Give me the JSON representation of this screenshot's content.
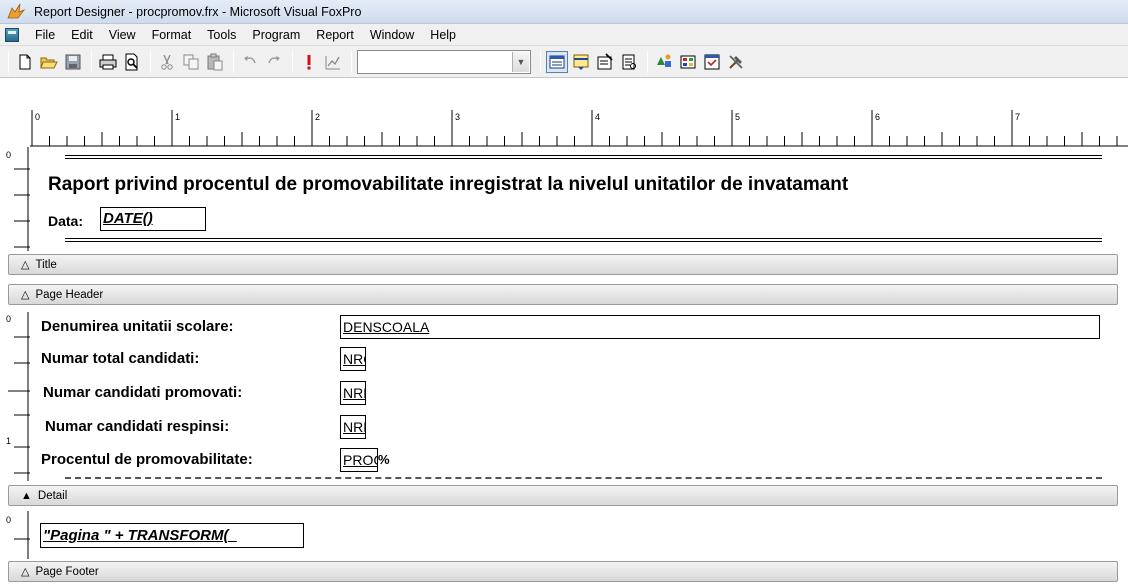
{
  "window": {
    "title": "Report Designer - procpromov.frx - Microsoft Visual FoxPro"
  },
  "menu": [
    "File",
    "Edit",
    "View",
    "Format",
    "Tools",
    "Program",
    "Report",
    "Window",
    "Help"
  ],
  "ruler": {
    "labels": [
      "0",
      "1",
      "2",
      "3",
      "4",
      "5",
      "6",
      "7"
    ]
  },
  "title_band": {
    "heading": "Raport privind procentul de promovabilitate inregistrat la nivelul unitatilor de invatamant",
    "date_label": "Data:",
    "date_expr": "DATE()",
    "bar_label": "Title"
  },
  "page_header_band": {
    "bar_label": "Page Header"
  },
  "detail_band": {
    "rows": [
      {
        "label": "Denumirea unitatii scolare:",
        "field": "DENSCOALA"
      },
      {
        "label": "Numar total candidati:",
        "field": "NRC"
      },
      {
        "label": "Numar candidati promovati:",
        "field": "NRP"
      },
      {
        "label": "Numar candidati respinsi:",
        "field": "NRR"
      },
      {
        "label": "Procentul de promovabilitate:",
        "field": "PROC"
      }
    ],
    "percent_sign": "%",
    "bar_label": "Detail"
  },
  "page_footer_band": {
    "expr": "\"Pagina \" + TRANSFORM(_",
    "bar_label": "Page Footer"
  },
  "vruler_labels": [
    "0",
    "0",
    "1",
    "0"
  ]
}
